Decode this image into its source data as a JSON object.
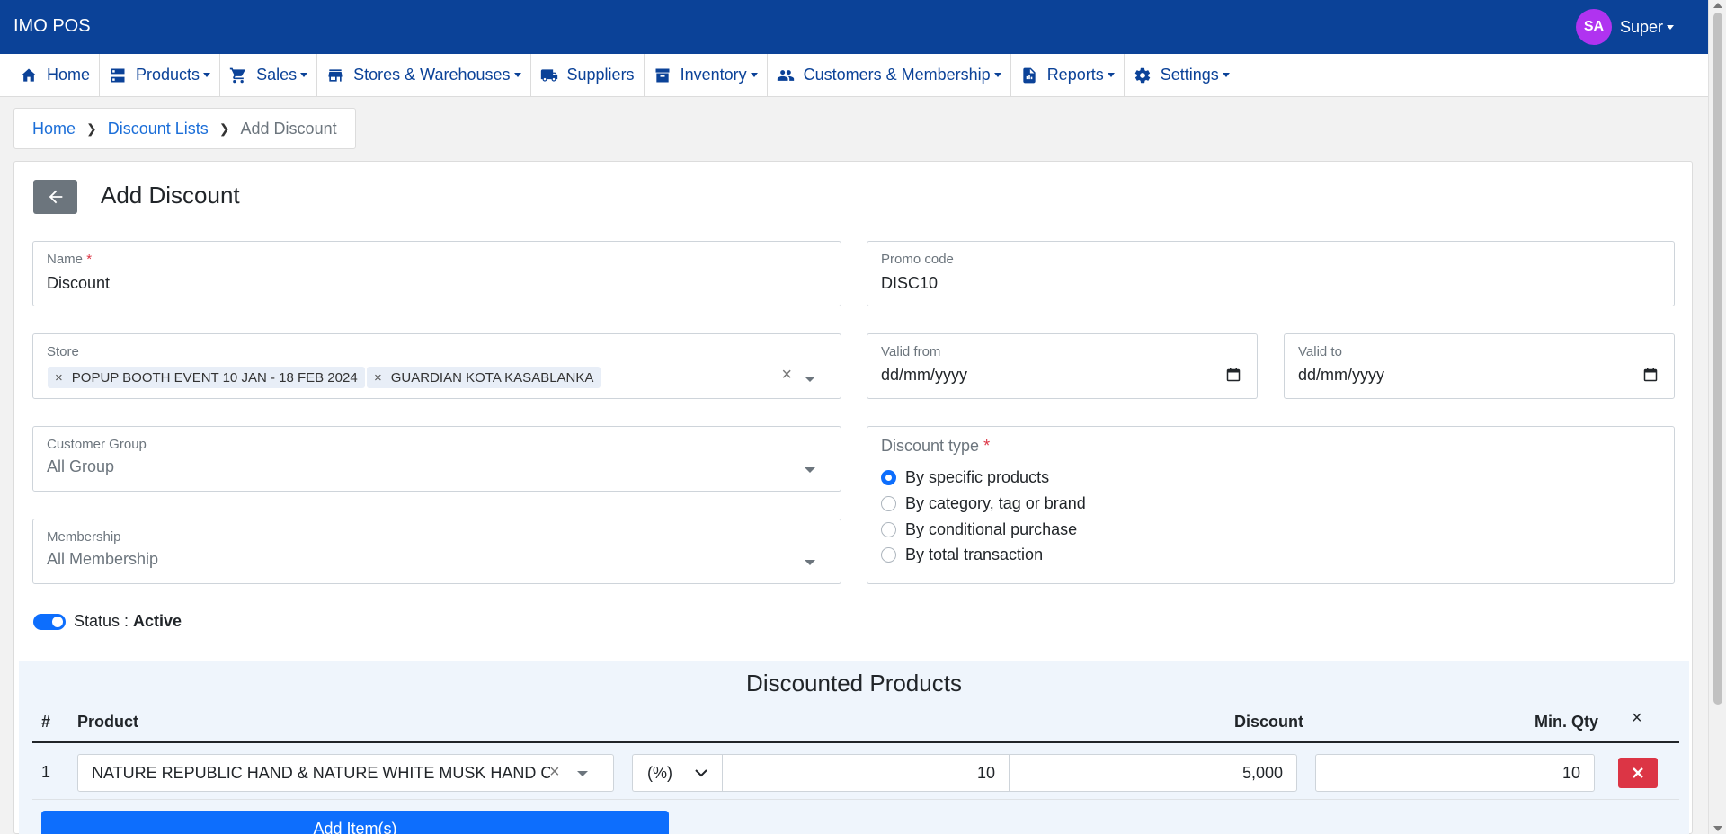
{
  "app": {
    "title": "IMO POS"
  },
  "user": {
    "initials": "SA",
    "name": "Super"
  },
  "nav": {
    "home": "Home",
    "products": "Products",
    "sales": "Sales",
    "stores": "Stores & Warehouses",
    "suppliers": "Suppliers",
    "inventory": "Inventory",
    "customers": "Customers & Membership",
    "reports": "Reports",
    "settings": "Settings"
  },
  "breadcrumb": {
    "home": "Home",
    "list": "Discount Lists",
    "current": "Add Discount"
  },
  "page": {
    "title": "Add Discount"
  },
  "form": {
    "name": {
      "label": "Name",
      "required": "*",
      "value": "Discount"
    },
    "promo": {
      "label": "Promo code",
      "value": "DISC10"
    },
    "store": {
      "label": "Store",
      "chips": [
        "POPUP BOOTH EVENT 10 JAN - 18 FEB 2024",
        "GUARDIAN KOTA KASABLANKA"
      ],
      "chip_remove": "×",
      "clear": "×"
    },
    "valid_from": {
      "label": "Valid from",
      "value": "dd/mm/yyyy"
    },
    "valid_to": {
      "label": "Valid to",
      "value": "dd/mm/yyyy"
    },
    "customer_group": {
      "label": "Customer Group",
      "value": "All Group"
    },
    "membership": {
      "label": "Membership",
      "value": "All Membership"
    },
    "discount_type": {
      "label": "Discount type",
      "required": "*",
      "options": [
        "By specific products",
        "By category, tag or brand",
        "By conditional purchase",
        "By total transaction"
      ],
      "selected": "By specific products"
    },
    "status": {
      "label": "Status :",
      "value": "Active",
      "on": true
    }
  },
  "discounted_products": {
    "title": "Discounted Products",
    "headers": {
      "num": "#",
      "product": "Product",
      "discount": "Discount",
      "min_qty": "Min. Qty",
      "close": "×"
    },
    "rows": [
      {
        "num": "1",
        "product": "NATURE REPUBLIC HAND & NATURE WHITE MUSK HAND CREAM",
        "product_clear": "×",
        "type": "(%)",
        "percent": "10",
        "amount": "5,000",
        "min_qty": "10"
      }
    ],
    "add_button": "Add Item(s)"
  },
  "colors": {
    "header": "#0b4298",
    "accent": "#0d6efd",
    "danger": "#dc3545",
    "avatar": "#b033f0"
  }
}
